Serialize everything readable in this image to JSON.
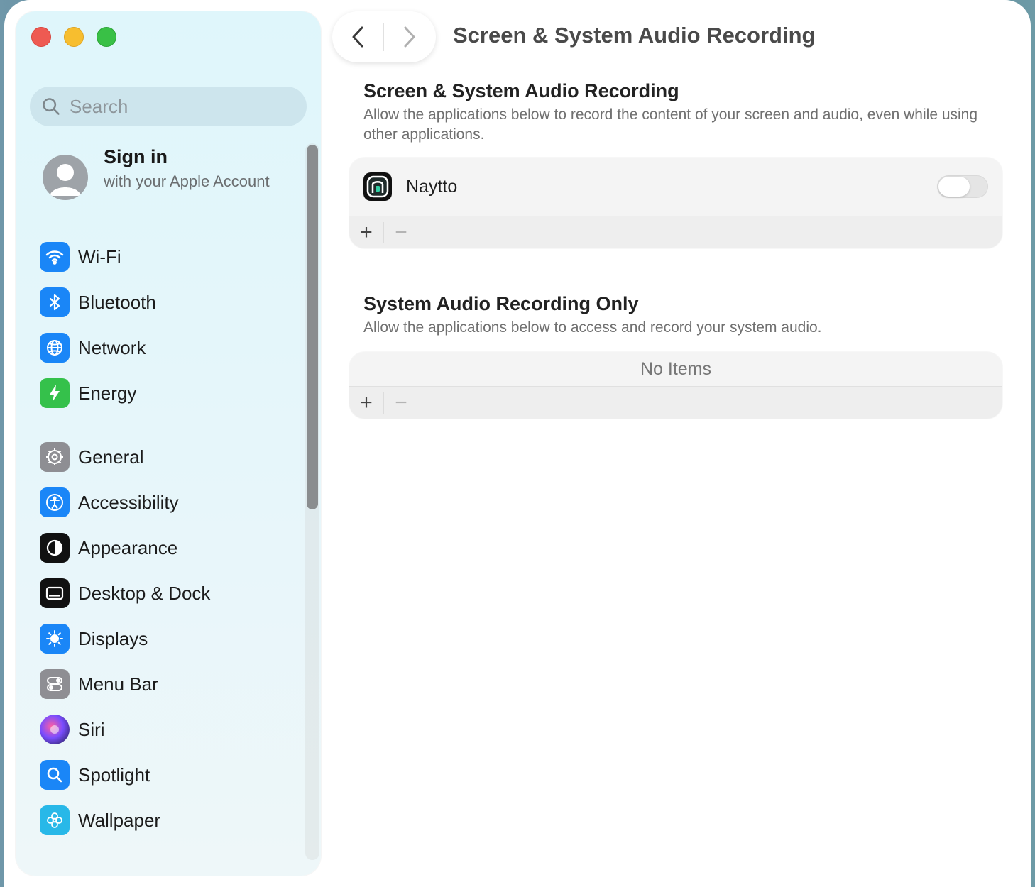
{
  "window": {
    "page_title": "Screen & System Audio Recording"
  },
  "sidebar": {
    "search_placeholder": "Search",
    "account": {
      "title": "Sign in",
      "subtitle": "with your Apple Account"
    },
    "items": [
      {
        "label": "Wi-Fi",
        "icon": "wifi-icon",
        "color": "#1a86f7"
      },
      {
        "label": "Bluetooth",
        "icon": "bluetooth-icon",
        "color": "#1a86f7"
      },
      {
        "label": "Network",
        "icon": "globe-icon",
        "color": "#1a86f7"
      },
      {
        "label": "Energy",
        "icon": "bolt-icon",
        "color": "#35c14b"
      },
      {
        "label": "General",
        "icon": "gear-icon",
        "color": "#8e8e93"
      },
      {
        "label": "Accessibility",
        "icon": "accessibility-icon",
        "color": "#1a86f7"
      },
      {
        "label": "Appearance",
        "icon": "appearance-icon",
        "color": "#111111"
      },
      {
        "label": "Desktop & Dock",
        "icon": "dock-icon",
        "color": "#111111"
      },
      {
        "label": "Displays",
        "icon": "sun-icon",
        "color": "#1a86f7"
      },
      {
        "label": "Menu Bar",
        "icon": "menubar-icon",
        "color": "#8e8e93"
      },
      {
        "label": "Siri",
        "icon": "siri-icon",
        "color": "#6a3fd1"
      },
      {
        "label": "Spotlight",
        "icon": "spotlight-icon",
        "color": "#1a86f7"
      },
      {
        "label": "Wallpaper",
        "icon": "flower-icon",
        "color": "#28b8e8"
      }
    ]
  },
  "main": {
    "section1": {
      "title": "Screen & System Audio Recording",
      "description": "Allow the applications below to record the content of your screen and audio, even while using other applications.",
      "apps": [
        {
          "name": "Naytto",
          "enabled": false
        }
      ]
    },
    "section2": {
      "title": "System Audio Recording Only",
      "description": "Allow the applications below to access and record your system audio.",
      "empty_text": "No Items"
    },
    "add_symbol": "+",
    "remove_symbol": "−"
  }
}
